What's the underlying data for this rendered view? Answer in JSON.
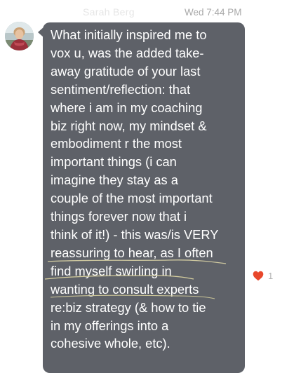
{
  "conversation": {
    "sender_name": "Sarah Berg",
    "timestamp": "Wed 7:44 PM"
  },
  "message": {
    "lines": [
      "What initially inspired me to",
      "vox u, was the added take-",
      "away gratitude of your last",
      "sentiment/reflection: that",
      "where i am in my coaching",
      "biz right now, my mindset &",
      "embodiment r the most",
      "important things (i can",
      "imagine they stay as a",
      "couple of the most important",
      "things forever now that i",
      "think of it!) - this was/is VERY",
      "reassuring to hear, as I often",
      "find myself swirling in",
      "wanting to consult experts",
      "re:biz strategy (& how to tie",
      "in my offerings into a",
      "cohesive whole, etc)."
    ],
    "bubble_color": "#5e6168",
    "text_color": "#ffffff"
  },
  "reaction": {
    "icon": "heart-icon",
    "count": "1",
    "color": "#e8472b"
  }
}
